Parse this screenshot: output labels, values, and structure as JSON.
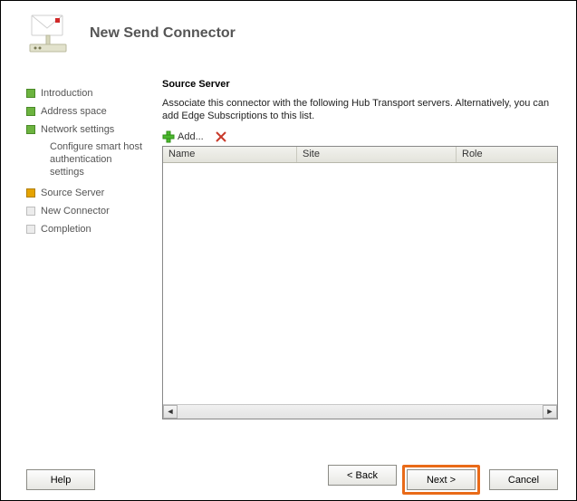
{
  "header": {
    "title": "New Send Connector"
  },
  "sidebar": {
    "steps": [
      {
        "label": "Introduction"
      },
      {
        "label": "Address space"
      },
      {
        "label": "Network settings"
      },
      {
        "label": "Source Server"
      },
      {
        "label": "New Connector"
      },
      {
        "label": "Completion"
      }
    ],
    "substep": "Configure smart host authentication settings"
  },
  "main": {
    "section_title": "Source Server",
    "description": "Associate this connector with the following Hub Transport servers. Alternatively, you can add Edge Subscriptions to this list.",
    "add_label": "Add...",
    "columns": {
      "c1": "Name",
      "c2": "Site",
      "c3": "Role"
    }
  },
  "footer": {
    "help": "Help",
    "back": "< Back",
    "next": "Next >",
    "cancel": "Cancel"
  }
}
